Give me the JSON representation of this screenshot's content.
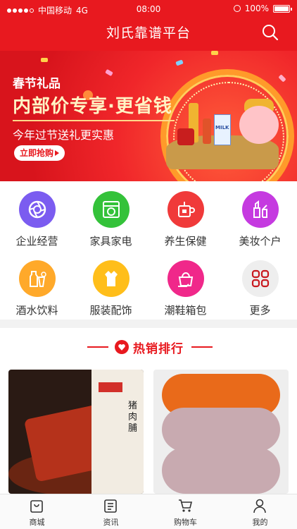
{
  "status_bar": {
    "carrier": "中国移动",
    "network": "4G",
    "time": "08:00",
    "battery": "100%"
  },
  "header": {
    "title": "刘氏靠谱平台"
  },
  "banner": {
    "kicker": "春节礼品",
    "headline": "内部价专享·更省钱",
    "subline": "今年过节送礼更实惠",
    "cta": "立即抢购",
    "package_text": "MILK"
  },
  "categories": [
    {
      "label": "企业经营",
      "icon": "aperture-icon",
      "color": "#7b5cf0"
    },
    {
      "label": "家具家电",
      "icon": "washing-machine-icon",
      "color": "#34c23a"
    },
    {
      "label": "养生保健",
      "icon": "teacup-icon",
      "color": "#f03a3a"
    },
    {
      "label": "美妆个户",
      "icon": "cosmetics-icon",
      "color": "#c53ae0"
    },
    {
      "label": "酒水饮料",
      "icon": "drinks-icon",
      "color": "#ffa92a"
    },
    {
      "label": "服装配饰",
      "icon": "dress-icon",
      "color": "#ffbe1a"
    },
    {
      "label": "潮鞋箱包",
      "icon": "handbag-icon",
      "color": "#f0288a"
    },
    {
      "label": "更多",
      "icon": "more-grid-icon",
      "color": "#eeeeee"
    }
  ],
  "hot_section": {
    "title": "热销排行"
  },
  "products": [
    {
      "image": "pork-jerky-photo",
      "package_label": "猪肉脯"
    },
    {
      "image": "dried-persimmon-photo"
    }
  ],
  "tabbar": [
    {
      "label": "商城",
      "icon": "shop-bag-icon"
    },
    {
      "label": "资讯",
      "icon": "news-icon"
    },
    {
      "label": "购物车",
      "icon": "cart-icon"
    },
    {
      "label": "我的",
      "icon": "user-icon"
    }
  ]
}
